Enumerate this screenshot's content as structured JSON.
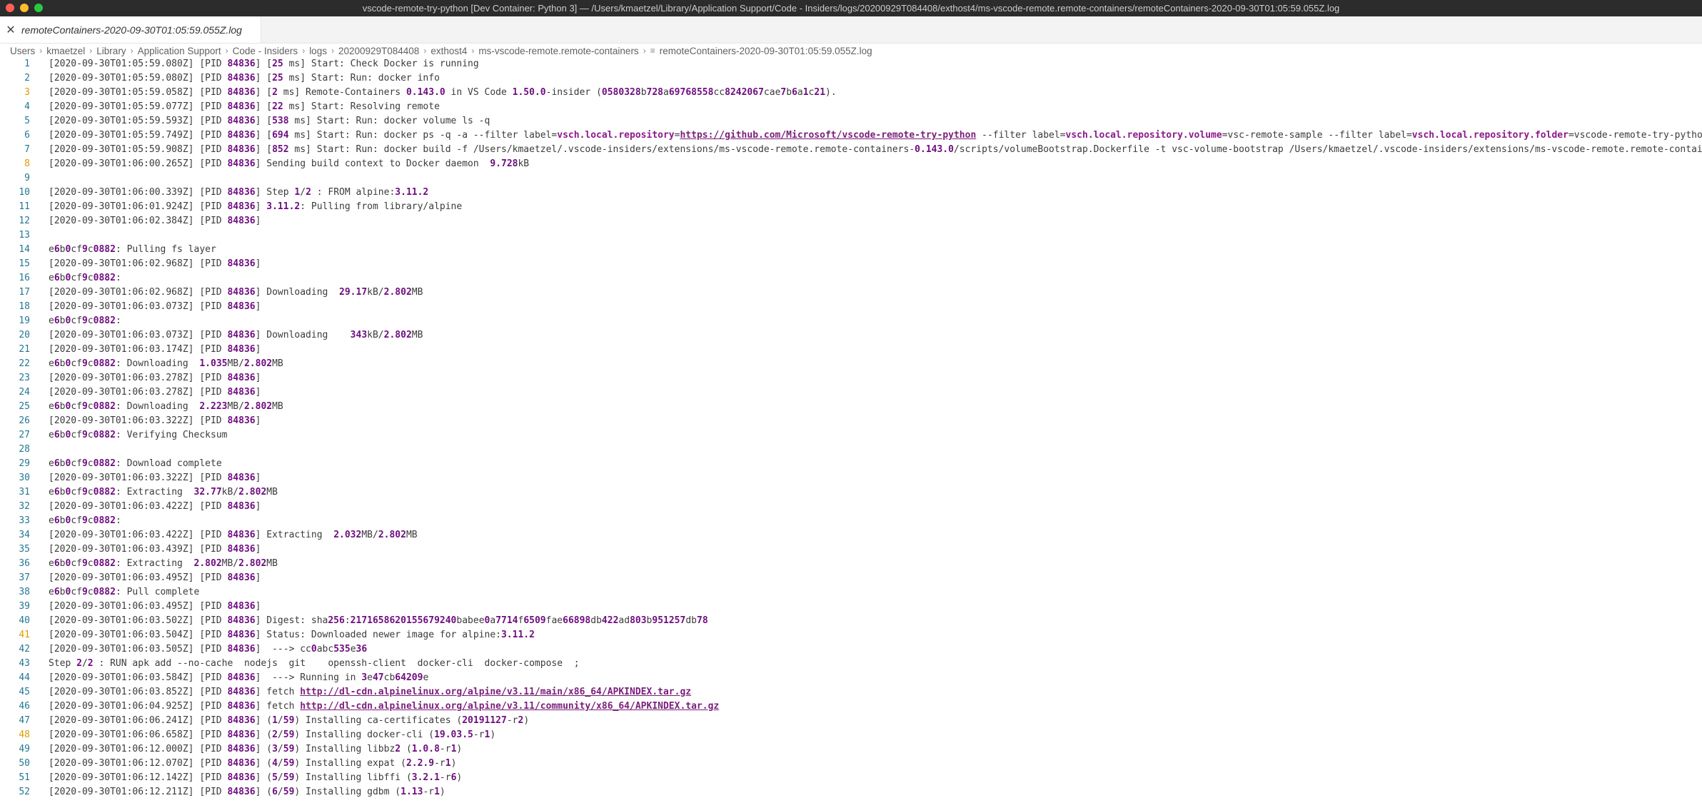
{
  "window": {
    "title": "vscode-remote-try-python [Dev Container: Python 3] — /Users/kmaetzel/Library/Application Support/Code - Insiders/logs/20200929T084408/exthost4/ms-vscode-remote.remote-containers/remoteContainers-2020-09-30T01:05:59.055Z.log"
  },
  "tab": {
    "label": "remoteContainers-2020-09-30T01:05:59.055Z.log",
    "close_glyph": "✕"
  },
  "breadcrumb": [
    "Users",
    "kmaetzel",
    "Library",
    "Application Support",
    "Code - Insiders",
    "logs",
    "20200929T084408",
    "exthost4",
    "ms-vscode-remote.remote-containers",
    "remoteContainers-2020-09-30T01:05:59.055Z.log"
  ],
  "lines": [
    {
      "n": "1",
      "t": "[2020-09-30T01:05:59.080Z] [PID 84836] [25 ms] Start: Check Docker is running"
    },
    {
      "n": "2",
      "t": "[2020-09-30T01:05:59.080Z] [PID 84836] [25 ms] Start: Run: docker info"
    },
    {
      "n": "3",
      "t": "[2020-09-30T01:05:59.058Z] [PID 84836] [2 ms] Remote-Containers 0.143.0 in VS Code 1.50.0-insider (0580328b728a69768558cc8242067cae7b6a1c21)."
    },
    {
      "n": "4",
      "t": "[2020-09-30T01:05:59.077Z] [PID 84836] [22 ms] Start: Resolving remote"
    },
    {
      "n": "5",
      "t": "[2020-09-30T01:05:59.593Z] [PID 84836] [538 ms] Start: Run: docker volume ls -q"
    },
    {
      "n": "6",
      "t": "[2020-09-30T01:05:59.749Z] [PID 84836] [694 ms] Start: Run: docker ps -q -a --filter label=vsch.local.repository=https://github.com/Microsoft/vscode-remote-try-python --filter label=vsch.local.repository.volume=vsc-remote-sample --filter label=vsch.local.repository.folder=vscode-remote-try-pytho"
    },
    {
      "n": "7",
      "t": "[2020-09-30T01:05:59.908Z] [PID 84836] [852 ms] Start: Run: docker build -f /Users/kmaetzel/.vscode-insiders/extensions/ms-vscode-remote.remote-containers-0.143.0/scripts/volumeBootstrap.Dockerfile -t vsc-volume-bootstrap /Users/kmaetzel/.vscode-insiders/extensions/ms-vscode-remote.remote-contai"
    },
    {
      "n": "8",
      "t": "[2020-09-30T01:06:00.265Z] [PID 84836] Sending build context to Docker daemon  9.728kB"
    },
    {
      "n": "9",
      "t": ""
    },
    {
      "n": "10",
      "t": "[2020-09-30T01:06:00.339Z] [PID 84836] Step 1/2 : FROM alpine:3.11.2"
    },
    {
      "n": "11",
      "t": "[2020-09-30T01:06:01.924Z] [PID 84836] 3.11.2: Pulling from library/alpine"
    },
    {
      "n": "12",
      "t": "[2020-09-30T01:06:02.384Z] [PID 84836]"
    },
    {
      "n": "13",
      "t": ""
    },
    {
      "n": "14",
      "t": "e6b0cf9c0882: Pulling fs layer"
    },
    {
      "n": "15",
      "t": "[2020-09-30T01:06:02.968Z] [PID 84836]"
    },
    {
      "n": "16",
      "t": "e6b0cf9c0882:"
    },
    {
      "n": "17",
      "t": "[2020-09-30T01:06:02.968Z] [PID 84836] Downloading  29.17kB/2.802MB"
    },
    {
      "n": "18",
      "t": "[2020-09-30T01:06:03.073Z] [PID 84836]"
    },
    {
      "n": "19",
      "t": "e6b0cf9c0882:"
    },
    {
      "n": "20",
      "t": "[2020-09-30T01:06:03.073Z] [PID 84836] Downloading    343kB/2.802MB"
    },
    {
      "n": "21",
      "t": "[2020-09-30T01:06:03.174Z] [PID 84836]"
    },
    {
      "n": "22",
      "t": "e6b0cf9c0882: Downloading  1.035MB/2.802MB"
    },
    {
      "n": "23",
      "t": "[2020-09-30T01:06:03.278Z] [PID 84836]"
    },
    {
      "n": "24",
      "t": "[2020-09-30T01:06:03.278Z] [PID 84836]"
    },
    {
      "n": "25",
      "t": "e6b0cf9c0882: Downloading  2.223MB/2.802MB"
    },
    {
      "n": "26",
      "t": "[2020-09-30T01:06:03.322Z] [PID 84836]"
    },
    {
      "n": "27",
      "t": "e6b0cf9c0882: Verifying Checksum"
    },
    {
      "n": "28",
      "t": ""
    },
    {
      "n": "29",
      "t": "e6b0cf9c0882: Download complete"
    },
    {
      "n": "30",
      "t": "[2020-09-30T01:06:03.322Z] [PID 84836]"
    },
    {
      "n": "31",
      "t": "e6b0cf9c0882: Extracting  32.77kB/2.802MB"
    },
    {
      "n": "32",
      "t": "[2020-09-30T01:06:03.422Z] [PID 84836]"
    },
    {
      "n": "33",
      "t": "e6b0cf9c0882:"
    },
    {
      "n": "34",
      "t": "[2020-09-30T01:06:03.422Z] [PID 84836] Extracting  2.032MB/2.802MB"
    },
    {
      "n": "35",
      "t": "[2020-09-30T01:06:03.439Z] [PID 84836]"
    },
    {
      "n": "36",
      "t": "e6b0cf9c0882: Extracting  2.802MB/2.802MB"
    },
    {
      "n": "37",
      "t": "[2020-09-30T01:06:03.495Z] [PID 84836]"
    },
    {
      "n": "38",
      "t": "e6b0cf9c0882: Pull complete"
    },
    {
      "n": "39",
      "t": "[2020-09-30T01:06:03.495Z] [PID 84836]"
    },
    {
      "n": "40",
      "t": "[2020-09-30T01:06:03.502Z] [PID 84836] Digest: sha256:2171658620155679240babee0a7714f6509fae66898db422ad803b951257db78"
    },
    {
      "n": "41",
      "t": "[2020-09-30T01:06:03.504Z] [PID 84836] Status: Downloaded newer image for alpine:3.11.2"
    },
    {
      "n": "42",
      "t": "[2020-09-30T01:06:03.505Z] [PID 84836]  ---> cc0abc535e36"
    },
    {
      "n": "43",
      "t": "Step 2/2 : RUN apk add --no-cache  nodejs  git    openssh-client  docker-cli  docker-compose  ;"
    },
    {
      "n": "44",
      "t": "[2020-09-30T01:06:03.584Z] [PID 84836]  ---> Running in 3e47cb64209e"
    },
    {
      "n": "45",
      "t": "[2020-09-30T01:06:03.852Z] [PID 84836] fetch http://dl-cdn.alpinelinux.org/alpine/v3.11/main/x86_64/APKINDEX.tar.gz"
    },
    {
      "n": "46",
      "t": "[2020-09-30T01:06:04.925Z] [PID 84836] fetch http://dl-cdn.alpinelinux.org/alpine/v3.11/community/x86_64/APKINDEX.tar.gz"
    },
    {
      "n": "47",
      "t": "[2020-09-30T01:06:06.241Z] [PID 84836] (1/59) Installing ca-certificates (20191127-r2)"
    },
    {
      "n": "48",
      "t": "[2020-09-30T01:06:06.658Z] [PID 84836] (2/59) Installing docker-cli (19.03.5-r1)"
    },
    {
      "n": "49",
      "t": "[2020-09-30T01:06:12.000Z] [PID 84836] (3/59) Installing libbz2 (1.0.8-r1)"
    },
    {
      "n": "50",
      "t": "[2020-09-30T01:06:12.070Z] [PID 84836] (4/59) Installing expat (2.2.9-r1)"
    },
    {
      "n": "51",
      "t": "[2020-09-30T01:06:12.142Z] [PID 84836] (5/59) Installing libffi (3.2.1-r6)"
    },
    {
      "n": "52",
      "t": "[2020-09-30T01:06:12.211Z] [PID 84836] (6/59) Installing gdbm (1.13-r1)"
    }
  ],
  "highlight_lines": [
    "3",
    "8",
    "41",
    "48"
  ],
  "colors": {
    "line_number": "#237893",
    "line_number_active": "#e09b00",
    "number": "#6f0e80",
    "selection": "#add6ff"
  }
}
